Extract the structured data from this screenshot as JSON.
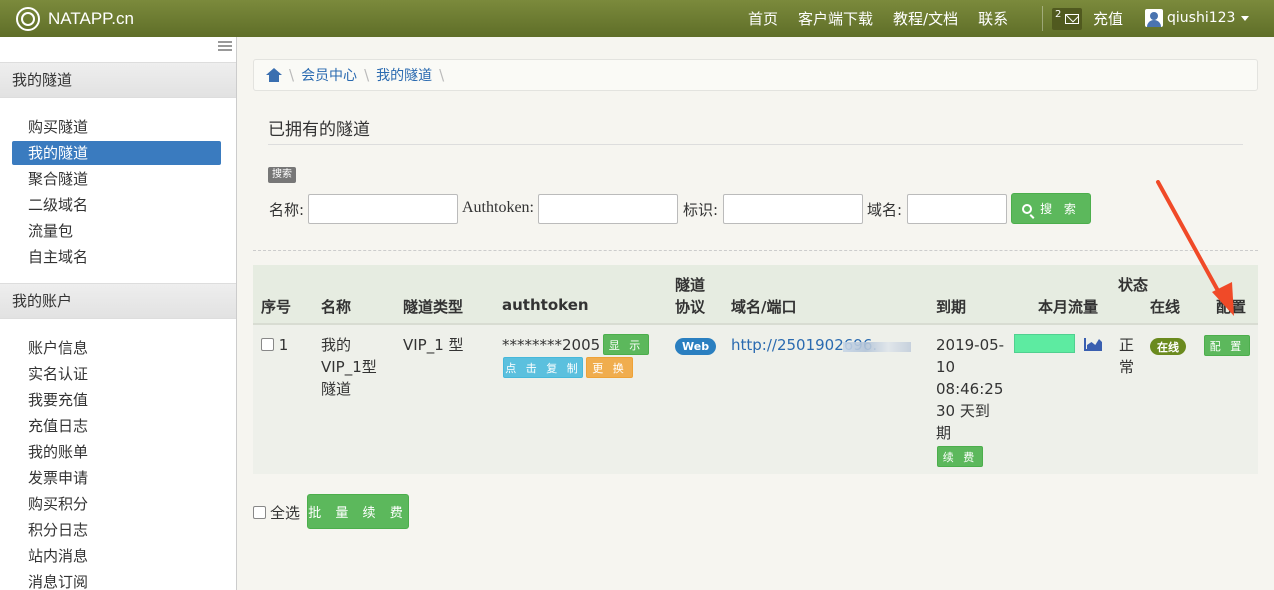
{
  "brand": {
    "name": "NATAPP.cn"
  },
  "topnav": {
    "items": [
      "首页",
      "客户端下载",
      "教程/文档",
      "联系"
    ],
    "mail_count": "2",
    "recharge": "充值",
    "username": "qiushi123"
  },
  "sidebar": {
    "section_tunnels": "我的隧道",
    "tunnel_items": [
      "购买隧道",
      "我的隧道",
      "聚合隧道",
      "二级域名",
      "流量包",
      "自主域名"
    ],
    "section_account": "我的账户",
    "account_items": [
      "账户信息",
      "实名认证",
      "我要充值",
      "充值日志",
      "我的账单",
      "发票申请",
      "购买积分",
      "积分日志",
      "站内消息",
      "消息订阅"
    ]
  },
  "breadcrumb": [
    "会员中心",
    "我的隧道"
  ],
  "page": {
    "title": "已拥有的隧道",
    "search_tag": "搜索",
    "filters": {
      "name_label": "名称:",
      "authtoken_label": "Authtoken:",
      "tag_label": "标识:",
      "domain_label": "域名:",
      "search_button": "搜 索"
    }
  },
  "table": {
    "headers": {
      "index": "序号",
      "name": "名称",
      "type": "隧道类型",
      "authtoken": "authtoken",
      "protocol_line1": "隧道",
      "protocol_line2": "协议",
      "domain": "域名/端口",
      "expiry": "到期",
      "traffic": "本月流量",
      "status_line1": "状态",
      "online": "在线",
      "config": "配置"
    },
    "rows": [
      {
        "index": "1",
        "name_line1": "我的",
        "name_line2": "VIP_1型",
        "name_line3": "隧道",
        "type": "VIP_1 型",
        "authtoken": "********2005",
        "show_button": "显 示",
        "copy_button": "点 击 复 制",
        "change_button": "更 换",
        "protocol": "Web",
        "domain": "http://2501902696.",
        "expiry_line1": "2019-05-",
        "expiry_line2": "10",
        "expiry_line3": "08:46:25",
        "expiry_line4": "30 天到",
        "expiry_line5": "期",
        "renew_button": "续 费",
        "status_line1": "正",
        "status_line2": "常",
        "online": "在线",
        "config_button": "配 置"
      }
    ]
  },
  "footer": {
    "select_all": "全选",
    "batch_renew": "批 量 续 费"
  },
  "colors": {
    "topbar": "#6a7932",
    "sidebar_active": "#3a7bbf",
    "button_green": "#5cb85c",
    "button_blue": "#5bc0de",
    "button_orange": "#f0ad4e",
    "arrow": "#f04a28"
  }
}
